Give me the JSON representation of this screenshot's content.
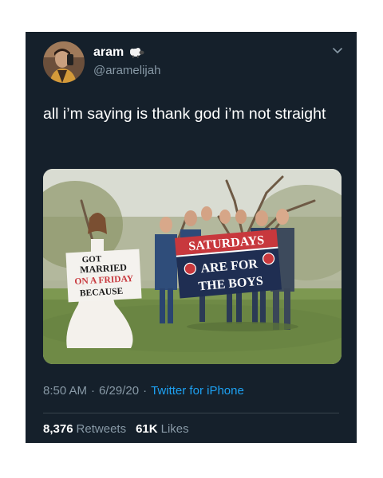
{
  "tweet": {
    "display_name": "aram",
    "name_emoji_icon": "sheep-icon",
    "handle": "@aramelijah",
    "text": "all i’m saying is thank god i’m not straight",
    "time": "8:50 AM",
    "date": "6/29/20",
    "dot": "·",
    "source": "Twitter for iPhone",
    "retweets_count": "8,376",
    "retweets_label": "Retweets",
    "likes_count": "61K",
    "likes_label": "Likes"
  },
  "photo": {
    "sign_left": [
      "GOT",
      "MARRIED",
      "ON A FRIDAY",
      "BECAUSE"
    ],
    "banner": [
      "SATURDAYS",
      "ARE FOR",
      "THE BOYS"
    ]
  },
  "colors": {
    "card_bg": "#15202b",
    "text_primary": "#ffffff",
    "text_secondary": "#8899a6",
    "link": "#1da1f2",
    "divider": "#38444d",
    "banner_red": "#c8383d",
    "banner_navy": "#1f2e52"
  }
}
